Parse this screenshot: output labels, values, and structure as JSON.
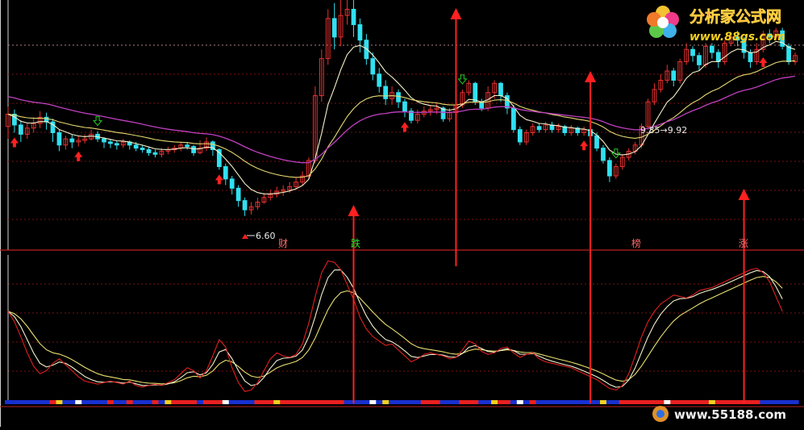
{
  "watermark_top": {
    "cn": "分析家公式网",
    "url": "www.88gs.com"
  },
  "watermark_bottom": {
    "url": "www.55188.com"
  },
  "colors": {
    "background": "#000000",
    "up_candle": "#e8312f",
    "down_candle": "#31e0f0",
    "ma_fast": "#f5f0c8",
    "ma_slow": "#e6d870",
    "ma_long": "#c040c0",
    "grid": "#7a1010",
    "signal": "#ff2020",
    "buy_marker": "#ff2020",
    "sell_marker": "#22cc22",
    "osc_k": "#e02020",
    "osc_d": "#f0f0d0",
    "osc_j": "#e8e070"
  },
  "chart_data": [
    {
      "type": "candlestick",
      "title": "",
      "xlabel": "",
      "ylabel": "",
      "ylim": [
        5.9,
        13.9
      ],
      "grid": true,
      "candles": [
        [
          9.8,
          10.2,
          10.45,
          9.4
        ],
        [
          10.2,
          9.85,
          10.35,
          9.6
        ],
        [
          9.85,
          9.55,
          10.0,
          9.3
        ],
        [
          9.55,
          9.75,
          9.9,
          9.4
        ],
        [
          9.75,
          9.9,
          10.1,
          9.6
        ],
        [
          9.9,
          10.1,
          10.3,
          9.75
        ],
        [
          10.1,
          9.95,
          10.25,
          9.7
        ],
        [
          9.95,
          9.6,
          10.05,
          9.3
        ],
        [
          9.6,
          9.2,
          9.7,
          9.0
        ],
        [
          9.2,
          9.4,
          9.5,
          9.05
        ],
        [
          9.4,
          9.3,
          9.55,
          9.1
        ],
        [
          9.3,
          9.35,
          9.5,
          9.15
        ],
        [
          9.35,
          9.4,
          9.55,
          9.25
        ],
        [
          9.4,
          9.55,
          9.7,
          9.35
        ],
        [
          9.55,
          9.4,
          9.65,
          9.3
        ],
        [
          9.4,
          9.3,
          9.45,
          9.1
        ],
        [
          9.3,
          9.25,
          9.4,
          9.1
        ],
        [
          9.25,
          9.2,
          9.35,
          9.05
        ],
        [
          9.2,
          9.3,
          9.4,
          9.1
        ],
        [
          9.3,
          9.2,
          9.35,
          9.05
        ],
        [
          9.2,
          9.1,
          9.3,
          9.0
        ],
        [
          9.1,
          9.05,
          9.2,
          8.95
        ],
        [
          9.05,
          8.95,
          9.15,
          8.85
        ],
        [
          8.95,
          8.9,
          9.05,
          8.8
        ],
        [
          8.9,
          9.0,
          9.1,
          8.8
        ],
        [
          9.0,
          9.05,
          9.15,
          8.9
        ],
        [
          9.05,
          9.1,
          9.2,
          8.95
        ],
        [
          9.1,
          9.2,
          9.3,
          9.0
        ],
        [
          9.2,
          9.15,
          9.3,
          9.05
        ],
        [
          9.15,
          8.95,
          9.2,
          8.85
        ],
        [
          8.95,
          9.1,
          9.35,
          8.9
        ],
        [
          9.1,
          9.3,
          9.45,
          9.0
        ],
        [
          9.3,
          9.05,
          9.35,
          8.85
        ],
        [
          9.05,
          8.5,
          9.1,
          8.4
        ],
        [
          8.5,
          8.1,
          8.6,
          7.9
        ],
        [
          8.1,
          7.8,
          8.2,
          7.6
        ],
        [
          7.8,
          7.4,
          7.9,
          7.2
        ],
        [
          7.4,
          7.1,
          7.5,
          6.9
        ],
        [
          7.1,
          7.2,
          7.35,
          6.95
        ],
        [
          7.2,
          7.35,
          7.5,
          7.1
        ],
        [
          7.35,
          7.5,
          7.65,
          7.3
        ],
        [
          7.5,
          7.6,
          7.75,
          7.4
        ],
        [
          7.6,
          7.7,
          7.85,
          7.5
        ],
        [
          7.7,
          7.75,
          7.9,
          7.55
        ],
        [
          7.75,
          7.85,
          8.0,
          7.65
        ],
        [
          7.85,
          8.0,
          8.15,
          7.75
        ],
        [
          8.0,
          8.2,
          8.35,
          7.9
        ],
        [
          8.2,
          8.7,
          8.8,
          8.1
        ],
        [
          8.7,
          10.8,
          11.1,
          8.6
        ],
        [
          10.8,
          12.0,
          12.3,
          10.6
        ],
        [
          12.0,
          13.3,
          13.6,
          11.8
        ],
        [
          13.3,
          12.7,
          13.8,
          12.3
        ],
        [
          12.7,
          13.4,
          13.9,
          12.4
        ],
        [
          13.4,
          13.6,
          13.9,
          13.1
        ],
        [
          13.6,
          13.1,
          13.9,
          12.7
        ],
        [
          13.1,
          12.6,
          13.3,
          12.2
        ],
        [
          12.6,
          12.0,
          12.8,
          11.8
        ],
        [
          12.0,
          11.5,
          12.2,
          11.3
        ],
        [
          11.5,
          11.1,
          11.7,
          10.9
        ],
        [
          11.1,
          10.7,
          11.3,
          10.5
        ],
        [
          10.7,
          10.9,
          11.1,
          10.5
        ],
        [
          10.9,
          10.6,
          11.0,
          10.4
        ],
        [
          10.6,
          10.3,
          10.7,
          10.1
        ],
        [
          10.3,
          10.0,
          10.4,
          9.9
        ],
        [
          10.0,
          10.2,
          10.35,
          9.9
        ],
        [
          10.2,
          10.3,
          10.45,
          10.1
        ],
        [
          10.3,
          10.35,
          10.5,
          10.15
        ],
        [
          10.35,
          10.4,
          10.55,
          10.2
        ],
        [
          10.4,
          10.05,
          10.45,
          9.95
        ],
        [
          10.05,
          10.25,
          10.4,
          9.95
        ],
        [
          10.25,
          10.5,
          10.65,
          10.15
        ],
        [
          10.5,
          10.9,
          11.0,
          10.4
        ],
        [
          10.9,
          11.2,
          11.3,
          10.8
        ],
        [
          11.2,
          10.6,
          11.25,
          10.5
        ],
        [
          10.6,
          10.4,
          10.7,
          10.3
        ],
        [
          10.4,
          10.9,
          11.1,
          10.3
        ],
        [
          10.9,
          11.2,
          11.3,
          10.7
        ],
        [
          11.2,
          10.8,
          11.25,
          10.6
        ],
        [
          10.8,
          10.4,
          10.9,
          10.2
        ],
        [
          10.4,
          9.7,
          10.5,
          9.6
        ],
        [
          9.7,
          9.3,
          9.8,
          9.2
        ],
        [
          9.3,
          9.6,
          9.7,
          9.2
        ],
        [
          9.6,
          9.8,
          9.9,
          9.5
        ],
        [
          9.8,
          9.7,
          9.9,
          9.6
        ],
        [
          9.7,
          9.85,
          9.95,
          9.6
        ],
        [
          9.85,
          9.7,
          9.95,
          9.6
        ],
        [
          9.7,
          9.8,
          9.9,
          9.6
        ],
        [
          9.8,
          9.6,
          9.85,
          9.5
        ],
        [
          9.6,
          9.75,
          9.85,
          9.5
        ],
        [
          9.75,
          9.6,
          9.8,
          9.5
        ],
        [
          9.6,
          9.7,
          9.8,
          9.5
        ],
        [
          9.7,
          9.5,
          9.75,
          9.4
        ],
        [
          9.5,
          9.1,
          9.6,
          9.0
        ],
        [
          9.1,
          8.7,
          9.2,
          8.6
        ],
        [
          8.7,
          8.2,
          8.8,
          8.0
        ],
        [
          8.2,
          8.5,
          8.6,
          8.1
        ],
        [
          8.5,
          8.8,
          8.9,
          8.4
        ],
        [
          8.8,
          9.0,
          9.1,
          8.7
        ],
        [
          9.0,
          9.2,
          9.3,
          8.9
        ],
        [
          9.2,
          9.8,
          9.9,
          9.1
        ],
        [
          9.8,
          10.6,
          10.7,
          9.7
        ],
        [
          10.6,
          11.0,
          11.2,
          10.5
        ],
        [
          11.0,
          11.3,
          11.5,
          10.9
        ],
        [
          11.3,
          11.6,
          11.8,
          11.2
        ],
        [
          11.6,
          11.3,
          11.7,
          11.1
        ],
        [
          11.3,
          11.9,
          12.0,
          11.2
        ],
        [
          11.9,
          12.3,
          12.5,
          11.8
        ],
        [
          12.3,
          12.1,
          12.4,
          11.9
        ],
        [
          12.1,
          11.8,
          12.2,
          11.6
        ],
        [
          11.8,
          12.4,
          12.5,
          11.7
        ],
        [
          12.4,
          12.2,
          12.5,
          12.0
        ],
        [
          12.2,
          11.9,
          12.3,
          11.7
        ],
        [
          11.9,
          12.5,
          12.6,
          11.8
        ],
        [
          12.5,
          12.7,
          12.8,
          12.4
        ],
        [
          12.7,
          12.6,
          12.9,
          12.4
        ],
        [
          12.6,
          12.2,
          12.7,
          12.0
        ],
        [
          12.2,
          11.9,
          12.3,
          11.7
        ],
        [
          11.9,
          12.3,
          12.5,
          11.8
        ],
        [
          12.3,
          12.8,
          12.9,
          12.2
        ],
        [
          12.8,
          12.7,
          12.95,
          12.5
        ],
        [
          12.7,
          12.9,
          13.0,
          12.6
        ],
        [
          12.9,
          12.4,
          13.0,
          12.3
        ],
        [
          12.4,
          11.9,
          12.5,
          11.8
        ],
        [
          11.9,
          12.1,
          12.2,
          11.8
        ]
      ],
      "annotations": [
        {
          "text": "6.60",
          "value": 6.6
        },
        {
          "text": "9.85→9.92",
          "value": 9.85
        }
      ],
      "buy_signals": [
        1,
        11,
        33,
        62,
        90,
        118
      ],
      "sell_signals": [
        14,
        71,
        95
      ],
      "signal_labels": [
        "财",
        "跌",
        "榜",
        "涨"
      ]
    },
    {
      "type": "line",
      "title": "",
      "xlabel": "",
      "ylabel": "",
      "ylim": [
        0,
        100
      ],
      "grid": true,
      "series_values": {
        "k": [
          62,
          55,
          45,
          34,
          25,
          20,
          22,
          27,
          30,
          26,
          22,
          18,
          15,
          14,
          13,
          14,
          15,
          14,
          13,
          15,
          12,
          11,
          12,
          13,
          12,
          14,
          16,
          20,
          24,
          22,
          17,
          22,
          32,
          43,
          38,
          24,
          14,
          8,
          9,
          14,
          22,
          30,
          34,
          32,
          31,
          33,
          40,
          54,
          72,
          88,
          96,
          95,
          90,
          80,
          70,
          58,
          50,
          45,
          42,
          39,
          40,
          36,
          32,
          28,
          30,
          33,
          34,
          33,
          32,
          30,
          31,
          36,
          42,
          40,
          35,
          33,
          34,
          37,
          38,
          34,
          31,
          33,
          34,
          30,
          28,
          27,
          26,
          25,
          24,
          22,
          20,
          18,
          16,
          13,
          10,
          9,
          12,
          20,
          32,
          45,
          55,
          62,
          67,
          70,
          73,
          72,
          71,
          73,
          76,
          77,
          78,
          80,
          82,
          84,
          86,
          88,
          90,
          91,
          88,
          82,
          72,
          62
        ]
      },
      "signal_columns": [
        54,
        70,
        91,
        115
      ]
    }
  ]
}
